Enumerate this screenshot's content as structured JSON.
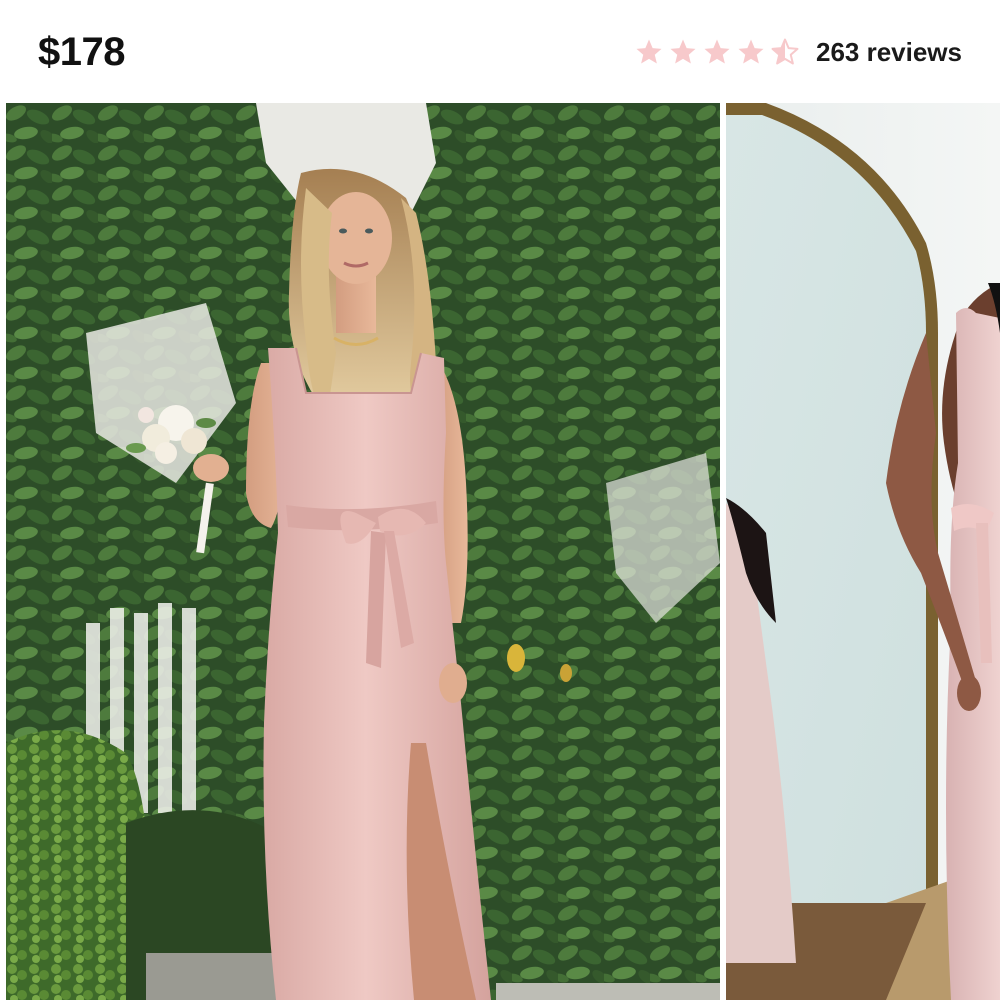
{
  "product": {
    "price": "$178",
    "rating": 4.5,
    "rating_max": 5,
    "reviews_label": "263 reviews"
  },
  "icons": {
    "star": "star-icon",
    "half_star": "half-star-icon"
  },
  "colors": {
    "star_fill": "#f7c9cb",
    "text": "#111111",
    "dress": "#e6b9b4"
  },
  "gallery": {
    "photos": [
      "woman in blush pink maxi dress holding bouquet",
      "woman in pink dress facing mirror"
    ]
  }
}
